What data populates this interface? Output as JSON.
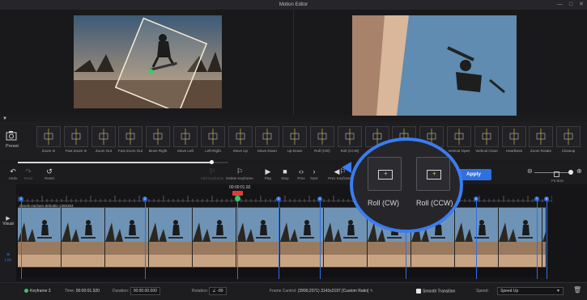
{
  "window": {
    "title": "Motion Editor"
  },
  "preset": {
    "label": "Preset"
  },
  "effects": [
    "Zoom In",
    "Fast Zoom In",
    "Zoom Out",
    "Fast Zoom Out",
    "Move Right",
    "Move Left",
    "Left-Right",
    "Move Up",
    "Move Down",
    "Up-Down",
    "Roll (CW)",
    "Roll (CCW)",
    "",
    "",
    "",
    "Vertical Open",
    "Vertical Close",
    "Heartbeat",
    "Zoom Rotate",
    "Closeup"
  ],
  "toolbar": {
    "undo": "Undo",
    "redo": "Redo",
    "reset": "Reset",
    "add_keyframe": "Add Keyframe",
    "delete_keyframe": "Delete Keyframe",
    "play": "Play",
    "stop": "Stop",
    "prev": "Prev",
    "next": "Next",
    "prev_keyframe": "Prev Keyframe",
    "apply": "Apply",
    "fit_size": "Fit Size"
  },
  "timeline": {
    "timecode": "00:00:01.92",
    "clip_name": "pexels-zachary-debottis-1365353",
    "nav": {
      "visual": "Visual",
      "list": "List"
    },
    "keyframes": [
      "1",
      "2",
      "3",
      "4",
      "5",
      "6",
      "7",
      "8"
    ]
  },
  "callout": {
    "left_label": "Roll (CW)",
    "right_label": "Roll (CCW)"
  },
  "status": {
    "keyframe": "Keyframe 3",
    "time_label": "Time:",
    "time_value": "00:00:01.920",
    "duration_label": "Duration:",
    "duration_value": "00:00:00.000",
    "rotation_label": "Rotation:",
    "rotation_value": "-89",
    "frame_control_label": "Frame Control:",
    "frame_control_value": "(3999,2071) 3143x2197 [Custom Ratio]",
    "smooth_transition": "Smooth Transition",
    "speed_label": "Speed:",
    "speed_value": "Speed Up"
  },
  "colors": {
    "accent": "#2f6fe0",
    "keyframe_green": "#35c46a",
    "playhead": "#e03b3b"
  }
}
